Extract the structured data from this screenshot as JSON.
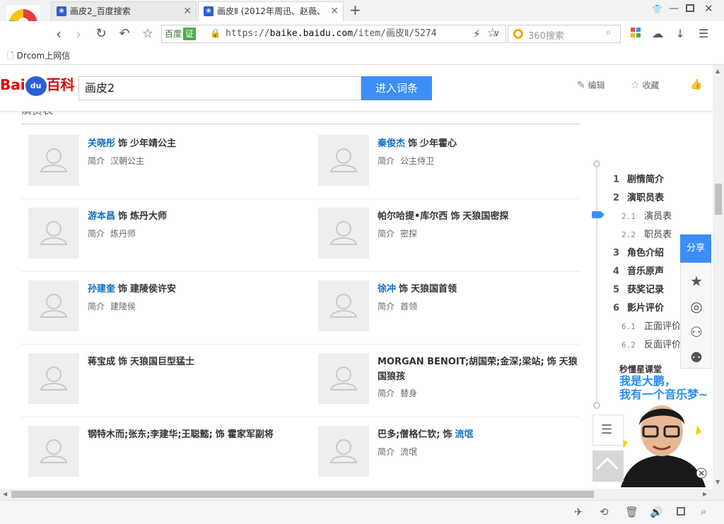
{
  "tabs": [
    {
      "title": "画皮2_百度搜索"
    },
    {
      "title": "画皮Ⅱ (2012年周迅、赵薇、"
    }
  ],
  "toolbar": {
    "site_tag": "百度",
    "site_verified": "证",
    "url_prefix": "https://",
    "url_host": "baike.baidu.com",
    "url_path": "/item/画皮Ⅱ/5274",
    "search_placeholder": "360搜索"
  },
  "bookmarks": [
    {
      "label": "Drcom上网信"
    }
  ],
  "baike": {
    "logo_text": "Bai",
    "logo_du": "du",
    "logo_suffix": "百科",
    "search_value": "画皮2",
    "go_button": "进入词条",
    "edit": "编辑",
    "favorite": "收藏"
  },
  "cast": {
    "section_title": "演员表",
    "intro_label": "简介",
    "role_word": "饰",
    "items": [
      {
        "actor": "关晓彤",
        "role": "少年靖公主",
        "intro": "汉朝公主",
        "linked": true
      },
      {
        "actor": "秦俊杰",
        "role": "少年霍心",
        "intro": "公主侍卫",
        "linked": true
      },
      {
        "actor": "游本昌",
        "role": "炼丹大师",
        "intro": "炼丹师",
        "linked": true
      },
      {
        "actor": "帕尔哈提•库尔西",
        "role": "天狼国密探",
        "intro": "密探",
        "linked": false
      },
      {
        "actor": "孙建奎",
        "role": "建陵侯许安",
        "intro": "建陵侯",
        "linked": true
      },
      {
        "actor": "徐冲",
        "role": "天狼国首领",
        "intro": "首领",
        "linked": true
      },
      {
        "actor": "蒋宝成",
        "role": "天狼国巨型猛士",
        "intro": "",
        "linked": false
      },
      {
        "actor": "MORGAN BENOIT;胡国荣;金深;梁站;",
        "role": "天狼国狼孩",
        "intro": "替身",
        "linked": false
      },
      {
        "actor": "钢特木而;张东;李建华;王聪懿;",
        "role": "霍家军副将",
        "intro": "",
        "linked": false
      },
      {
        "actor": "巴多;僧格仁钦;",
        "role": "流氓",
        "intro": "流氓",
        "linked": false
      }
    ]
  },
  "toc": {
    "items": [
      {
        "num": "1",
        "label": "剧情简介"
      },
      {
        "num": "2",
        "label": "演职员表"
      },
      {
        "num": "2.1",
        "label": "演员表",
        "sub": true
      },
      {
        "num": "2.2",
        "label": "职员表",
        "sub": true
      },
      {
        "num": "3",
        "label": "角色介绍"
      },
      {
        "num": "4",
        "label": "音乐原声"
      },
      {
        "num": "5",
        "label": "获奖记录"
      },
      {
        "num": "6",
        "label": "影片评价"
      },
      {
        "num": "6.1",
        "label": "正面评价",
        "sub": true
      },
      {
        "num": "6.2",
        "label": "反面评价",
        "sub": true
      }
    ]
  },
  "share": {
    "label": "分享"
  },
  "ad": {
    "title": "秒懂星课堂",
    "line1": "我是大鹏，",
    "line2": "我有一个音乐梦~"
  },
  "colors": {
    "link": "#136ec2",
    "brand_blue": "#3e8ef7",
    "brand_red": "#e10602"
  }
}
